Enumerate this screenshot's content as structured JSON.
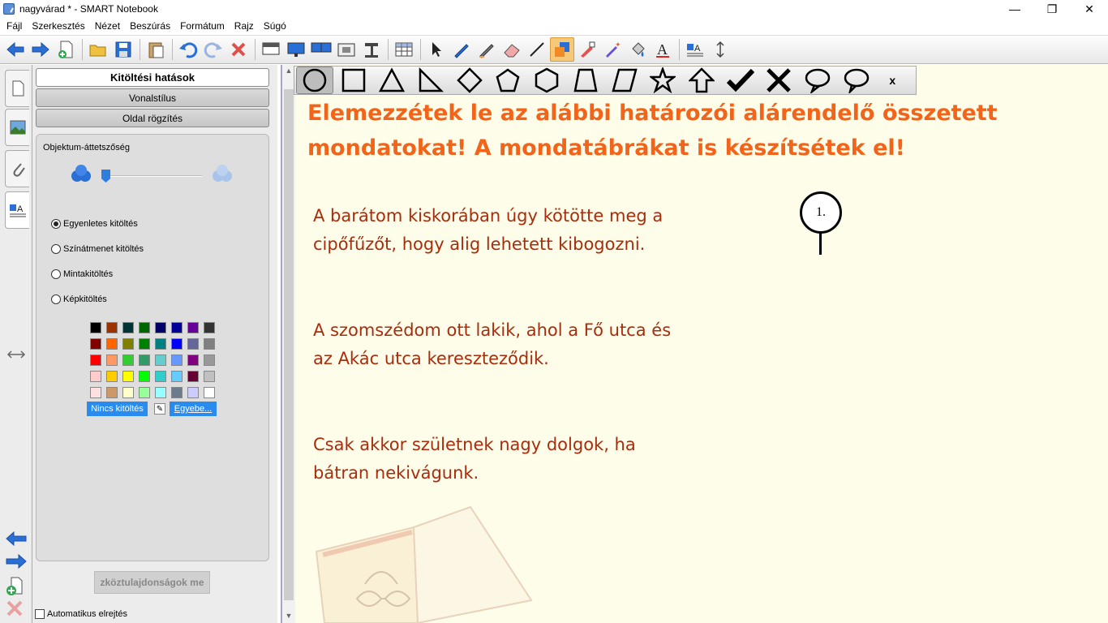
{
  "window": {
    "title": "nagyvárad * - SMART Notebook",
    "minimize": "—",
    "maximize": "❐",
    "close": "✕"
  },
  "menu": [
    "Fájl",
    "Szerkesztés",
    "Nézet",
    "Beszúrás",
    "Formátum",
    "Rajz",
    "Súgó"
  ],
  "toolbar": {
    "icons": [
      "back-arrow-icon",
      "forward-arrow-icon",
      "add-page-icon",
      "open-folder-icon",
      "save-icon",
      "paste-icon",
      "undo-icon",
      "redo-icon",
      "delete-icon",
      "screen-shade-icon",
      "full-screen-icon",
      "dual-display-icon",
      "screen-capture-icon",
      "document-camera-icon",
      "table-icon",
      "select-icon",
      "pen-icon",
      "creative-pen-icon",
      "eraser-icon",
      "line-icon",
      "shapes-icon",
      "regular-polygon-icon",
      "magic-pen-icon",
      "fill-icon",
      "text-icon",
      "properties-icon",
      "move-toolbar-icon"
    ],
    "active": "shapes-icon"
  },
  "properties": {
    "tabs": {
      "fill_effects": "Kitöltési hatások",
      "line_style": "Vonalstílus",
      "page_recording": "Oldal rögzítés"
    },
    "transparency_label": "Objektum-áttetszőség",
    "transparency_value": 0.0,
    "fill_options": [
      {
        "label": "Egyenletes kitöltés",
        "checked": true
      },
      {
        "label": "Színátmenet kitöltés",
        "checked": false
      },
      {
        "label": "Mintakitöltés",
        "checked": false
      },
      {
        "label": "Képkitöltés",
        "checked": false
      }
    ],
    "palette": [
      "#000000",
      "#993300",
      "#003333",
      "#006600",
      "#000066",
      "#000099",
      "#660099",
      "#333333",
      "#800000",
      "#ff6600",
      "#808000",
      "#008000",
      "#008080",
      "#0000ff",
      "#666699",
      "#808080",
      "#ff0000",
      "#ff9966",
      "#33cc33",
      "#339966",
      "#66cccc",
      "#6699ff",
      "#800080",
      "#999999",
      "#ffcccc",
      "#ffcc00",
      "#ffff00",
      "#00ff00",
      "#33cccc",
      "#66ccff",
      "#660033",
      "#c0c0c0",
      "#ffe0e0",
      "#cc9966",
      "#ffffcc",
      "#99ff99",
      "#99ffff",
      "#6c7c8c",
      "#ccccff",
      "#ffffff"
    ],
    "no_fill": "Nincs kitöltés",
    "more": "Egyebe...",
    "more_properties": "zköztulajdonságok me",
    "auto_hide": "Automatikus elrejtés"
  },
  "shapes": {
    "items": [
      "circle-shape",
      "square-shape",
      "triangle-shape",
      "right-triangle-shape",
      "diamond-shape",
      "pentagon-shape",
      "hexagon-shape",
      "trapezoid-shape",
      "parallelogram-shape",
      "star-shape",
      "arrow-up-shape",
      "checkmark-shape",
      "cross-shape",
      "speech-bubble-left-shape",
      "speech-bubble-right-shape"
    ],
    "active": "circle-shape",
    "close": "x"
  },
  "page": {
    "heading_line1": "Elemezzétek le az alábbi határozói alárendelő összetett",
    "heading_line2": "mondatokat! A mondatábrákat is készítsétek el!",
    "sentences": [
      {
        "line1": "A barátom kiskorában úgy kötötte meg a",
        "line2": "cipőfűzőt, hogy alig lehetett kibogozni."
      },
      {
        "line1": "A szomszédom ott lakik, ahol a Fő utca és",
        "line2": "az Akác utca kereszteződik."
      },
      {
        "line1": "Csak akkor születnek nagy dolgok, ha",
        "line2": "bátran nekivágunk."
      }
    ],
    "callout_number": "1."
  },
  "colors": {
    "heading": "#f26419",
    "text": "#a82d0e",
    "canvas": "#fefde9"
  }
}
